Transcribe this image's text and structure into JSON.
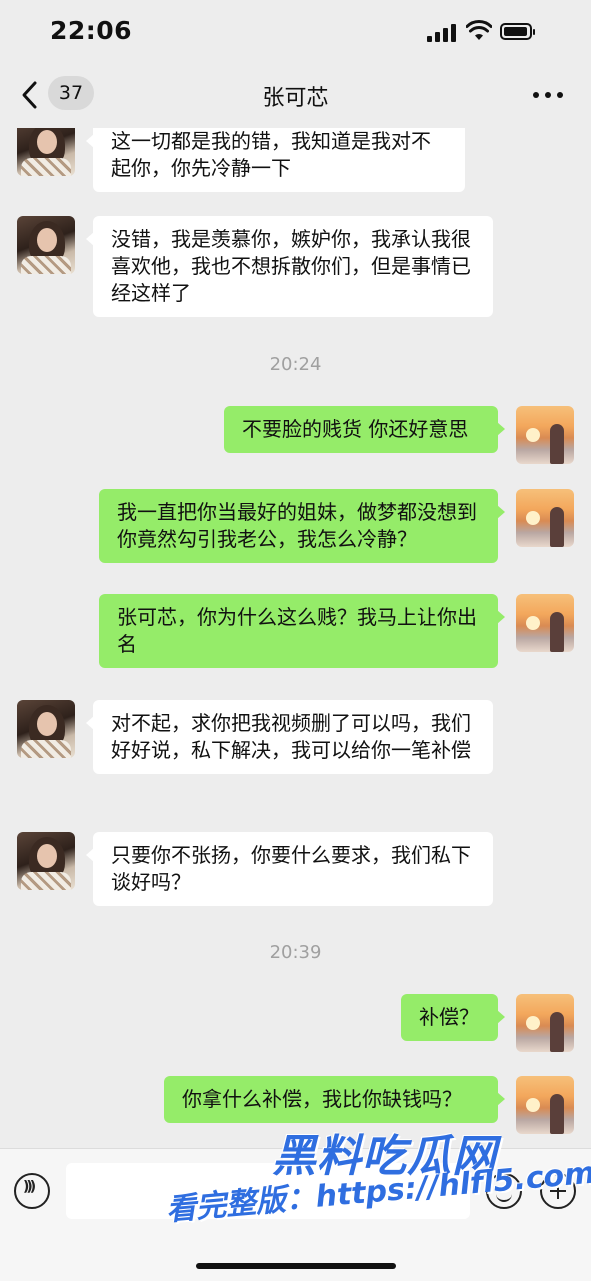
{
  "status_bar": {
    "time": "22:06"
  },
  "nav": {
    "unread_count": "37",
    "title": "张可芯"
  },
  "messages": [
    {
      "side": "left",
      "text": "这一切都是我的错，我知道是我对不起你，你先冷静一下"
    },
    {
      "side": "left",
      "text": "没错，我是羡慕你，嫉妒你，我承认我很喜欢他，我也不想拆散你们，但是事情已经这样了"
    },
    {
      "timestamp": "20:24"
    },
    {
      "side": "right",
      "text": "不要脸的贱货 你还好意思"
    },
    {
      "side": "right",
      "text": "我一直把你当最好的姐妹，做梦都没想到你竟然勾引我老公，我怎么冷静？"
    },
    {
      "side": "right",
      "text": "张可芯，你为什么这么贱？我马上让你出名"
    },
    {
      "side": "left",
      "text": "对不起，求你把我视频删了可以吗，我们好好说，私下解决，我可以给你一笔补偿"
    },
    {
      "side": "left",
      "text": "只要你不张扬，你要什么要求，我们私下谈好吗？"
    },
    {
      "timestamp": "20:39"
    },
    {
      "side": "right",
      "text": "补偿？"
    },
    {
      "side": "right",
      "text": "你拿什么补偿，我比你缺钱吗？"
    }
  ],
  "input": {
    "value": ""
  },
  "watermark": {
    "brand": "黑料吃瓜网",
    "url": "看完整版：https://hlfl5.com"
  }
}
